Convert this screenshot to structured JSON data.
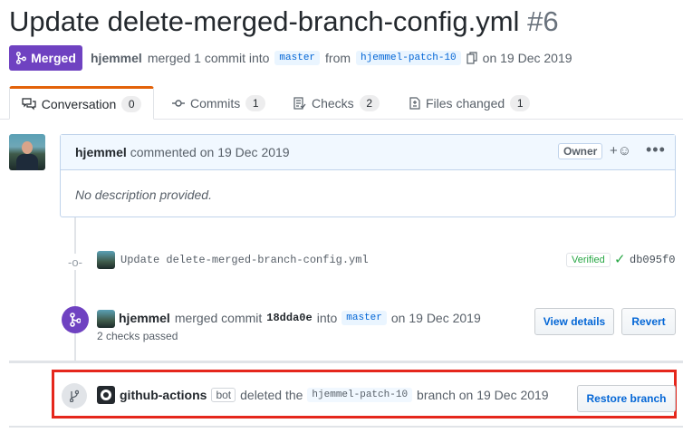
{
  "pr": {
    "title": "Update delete-merged-branch-config.yml",
    "number": "#6",
    "state": "Merged",
    "author": "hjemmel",
    "merge_text": "merged 1 commit into",
    "base_branch": "master",
    "from_text": "from",
    "head_branch": "hjemmel-patch-10",
    "date_text": "on 19 Dec 2019"
  },
  "tabs": [
    {
      "label": "Conversation",
      "count": "0"
    },
    {
      "label": "Commits",
      "count": "1"
    },
    {
      "label": "Checks",
      "count": "2"
    },
    {
      "label": "Files changed",
      "count": "1"
    }
  ],
  "comment": {
    "author": "hjemmel",
    "action": "commented on 19 Dec 2019",
    "role": "Owner",
    "body": "No description provided."
  },
  "commit": {
    "message": "Update delete-merged-branch-config.yml",
    "verified": "Verified",
    "sha": "db095f0"
  },
  "merge_event": {
    "author": "hjemmel",
    "text": "merged commit",
    "sha": "18dda0e",
    "into": "into",
    "branch": "master",
    "date": "on 19 Dec 2019",
    "checks": "2 checks passed",
    "view_details": "View details",
    "revert": "Revert"
  },
  "delete_event": {
    "actor": "github-actions",
    "bot": "bot",
    "text": "deleted the",
    "branch": "hjemmel-patch-10",
    "tail": "branch on 19 Dec 2019",
    "restore": "Restore branch"
  },
  "colors": {
    "merged_purple": "#6f42c1",
    "link_blue": "#0366d6",
    "verified_green": "#28a745",
    "highlight_red": "#e5271c"
  }
}
